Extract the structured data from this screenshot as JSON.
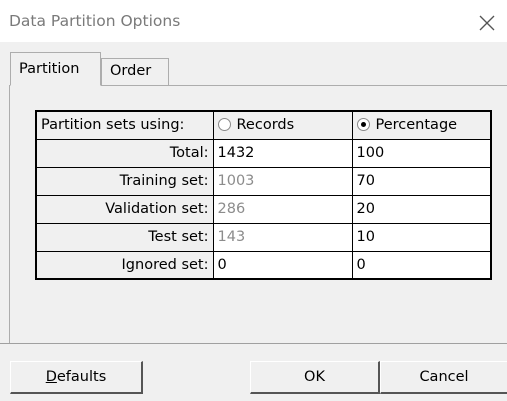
{
  "window": {
    "title": "Data Partition Options"
  },
  "tabs": [
    {
      "label": "Partition",
      "active": true
    },
    {
      "label": "Order",
      "active": false
    }
  ],
  "partition": {
    "header": {
      "label": "Partition sets using:",
      "records_option": "Records",
      "percentage_option": "Percentage",
      "selected": "Percentage"
    },
    "rows": [
      {
        "label": "Total:",
        "records": "1432",
        "percentage": "100"
      },
      {
        "label": "Training set:",
        "records": "1003",
        "percentage": "70"
      },
      {
        "label": "Validation set:",
        "records": "286",
        "percentage": "20"
      },
      {
        "label": "Test set:",
        "records": "143",
        "percentage": "10"
      },
      {
        "label": "Ignored set:",
        "records": "0",
        "percentage": "0"
      }
    ]
  },
  "buttons": {
    "defaults_first": "D",
    "defaults_rest": "efaults",
    "ok": "OK",
    "cancel": "Cancel"
  }
}
